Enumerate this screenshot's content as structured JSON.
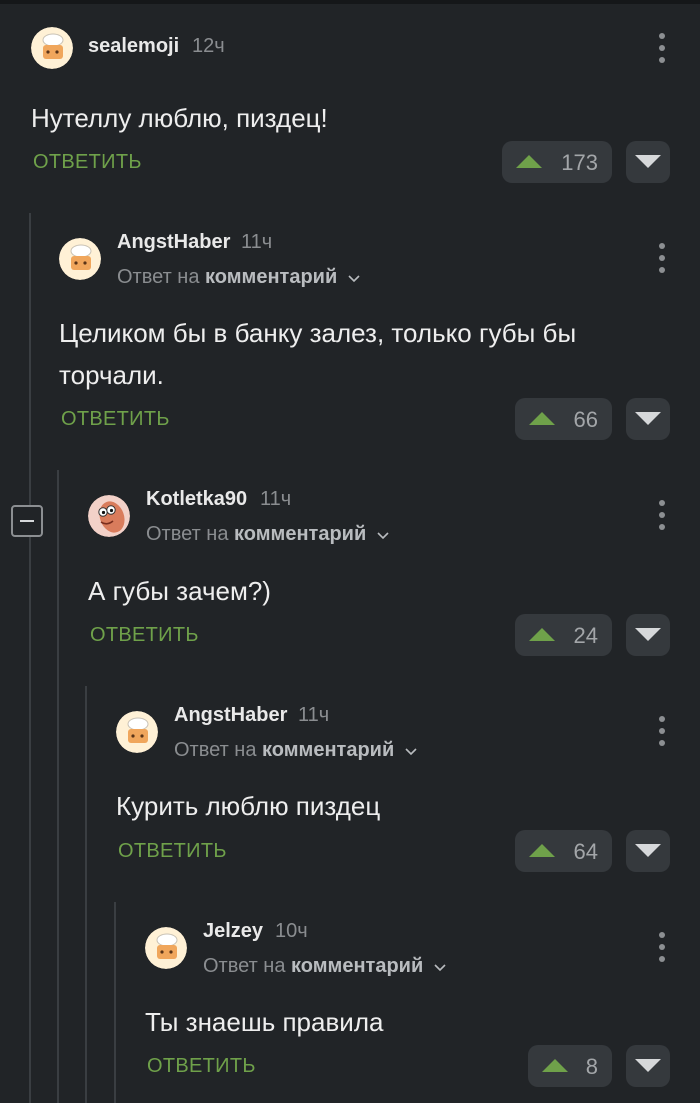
{
  "reply_label": "ОТВЕТИТЬ",
  "reply_prefix": "Ответ на",
  "reply_target": "комментарий",
  "colors": {
    "background": "#212427",
    "reply_accent": "#6fa14a",
    "upvote_arrow": "#6fa14a",
    "button_bg": "#35393d"
  },
  "comments": [
    {
      "username": "sealemoji",
      "time": "12ч",
      "text": "Нутеллу люблю, пиздец!",
      "votes": "173",
      "avatar_icon": "chef-avatar-icon"
    },
    {
      "username": "AngstHaber",
      "time": "11ч",
      "text": "Целиком бы в банку залез, только губы бы торчали.",
      "votes": "66",
      "avatar_icon": "chef-avatar-icon"
    },
    {
      "username": "Kotletka90",
      "time": "11ч",
      "text": "А губы зачем?)",
      "votes": "24",
      "avatar_icon": "sausage-avatar-icon"
    },
    {
      "username": "AngstHaber",
      "time": "11ч",
      "text": "Курить люблю пиздец",
      "votes": "64",
      "avatar_icon": "chef-avatar-icon"
    },
    {
      "username": "Jelzey",
      "time": "10ч",
      "text": "Ты знаешь правила",
      "votes": "8",
      "avatar_icon": "chef-avatar-icon"
    }
  ]
}
